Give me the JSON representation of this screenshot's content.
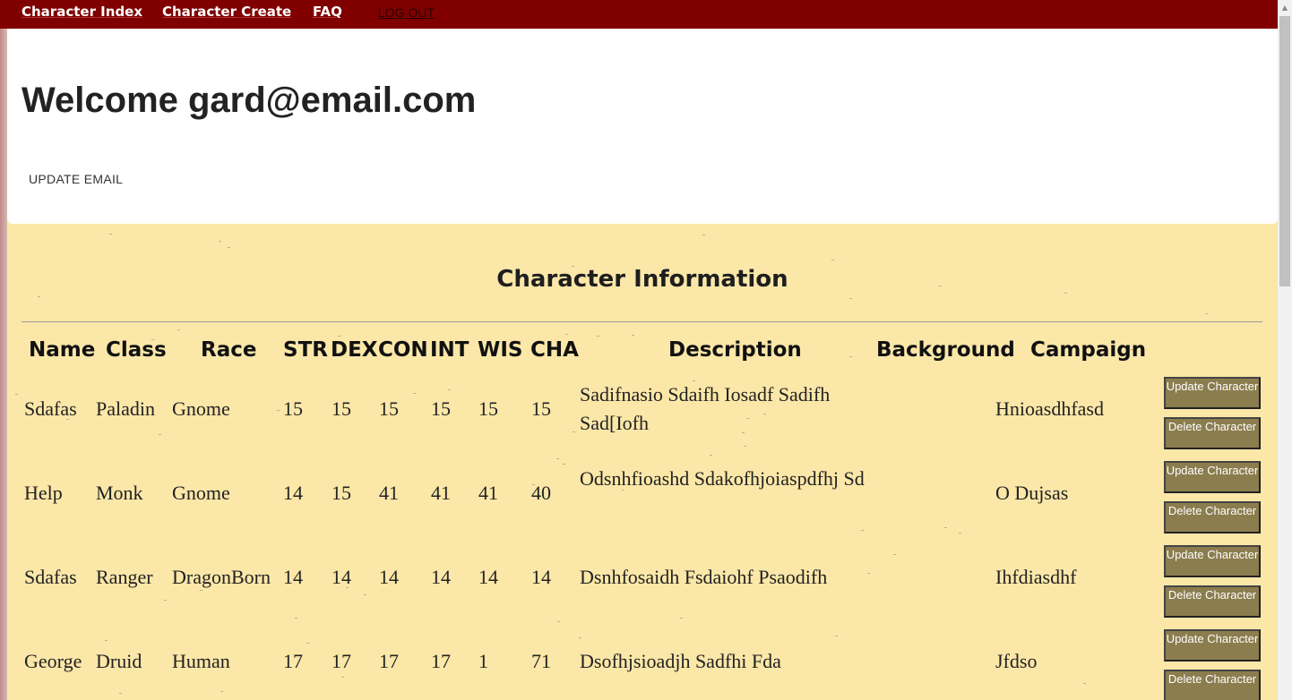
{
  "nav": {
    "items": [
      "Character Index",
      "Character Create",
      "FAQ"
    ],
    "logout_label": "LOG OUT"
  },
  "header": {
    "welcome": "Welcome gard@email.com",
    "update_email_label": "UPDATE EMAIL"
  },
  "section": {
    "title": "Character Information"
  },
  "table": {
    "headers": [
      "Name",
      "Class",
      "Race",
      "STR",
      "DEX",
      "CON",
      "INT",
      "WIS",
      "CHA",
      "Description",
      "Background",
      "Campaign"
    ],
    "rows": [
      {
        "name": "Sdafas",
        "class": "Paladin",
        "race": "Gnome",
        "str": "15",
        "dex": "15",
        "con": "15",
        "int": "15",
        "wis": "15",
        "cha": "15",
        "description": "Sadifnasio Sdaifh Iosadf Sadifh Sad[Iofh",
        "background": "",
        "campaign": "Hnioasdhfasd"
      },
      {
        "name": "Help",
        "class": "Monk",
        "race": "Gnome",
        "str": "14",
        "dex": "15",
        "con": "41",
        "int": "41",
        "wis": "41",
        "cha": "40",
        "description": "Odsnhfioashd Sdakofhjoiaspdfhj Sd",
        "background": "",
        "campaign": "O Dujsas"
      },
      {
        "name": "Sdafas",
        "class": "Ranger",
        "race": "DragonBorn",
        "str": "14",
        "dex": "14",
        "con": "14",
        "int": "14",
        "wis": "14",
        "cha": "14",
        "description": "Dsnhfosaidh Fsdaiohf Psaodifh",
        "background": "",
        "campaign": "Ihfdiasdhf"
      },
      {
        "name": "George",
        "class": "Druid",
        "race": "Human",
        "str": "17",
        "dex": "17",
        "con": "17",
        "int": "17",
        "wis": "1",
        "cha": "71",
        "description": "Dsofhjsioadjh Sadfhi Fda",
        "background": "",
        "campaign": "Jfdso"
      }
    ],
    "update_label": "Update Character",
    "delete_label": "Delete Character"
  },
  "colors": {
    "nav_bg": "#800000",
    "parchment": "#fbe7a8",
    "button_bg": "#8b7d4e"
  }
}
